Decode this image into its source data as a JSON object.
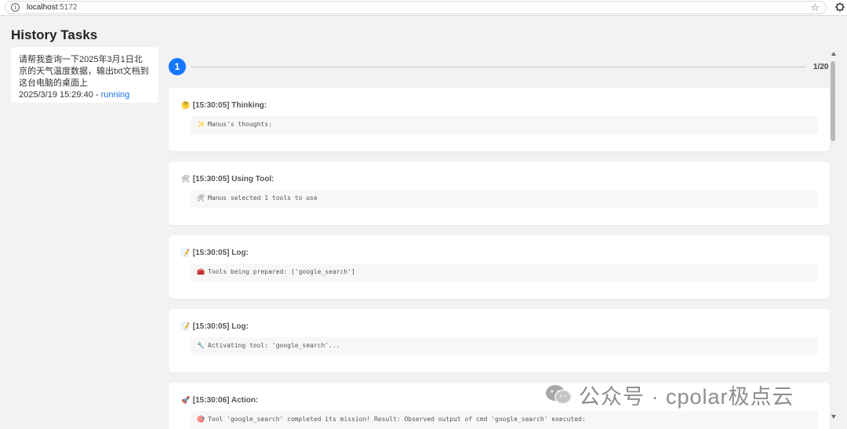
{
  "browser": {
    "url_host": "localhost",
    "url_port": ":5172"
  },
  "sidebar": {
    "title": "History Tasks",
    "tasks": [
      {
        "prompt": "请帮我查询一下2025年3月1日北京的天气温度数据，输出txt文档到这台电脑的桌面上",
        "timestamp": "2025/3/19 15:29:40",
        "separator": " - ",
        "status": "running"
      }
    ]
  },
  "stepper": {
    "current_step": "1",
    "count_label": "1/20"
  },
  "logs": [
    {
      "head_icon": "🤔",
      "title": "[15:30:05] Thinking:",
      "body_icon": "✨",
      "body": "Manus's thoughts:"
    },
    {
      "head_icon": "🛠",
      "title": "[15:30:05] Using Tool:",
      "body_icon": "🛠",
      "body": "Manus selected 1 tools to use"
    },
    {
      "head_icon": "📝",
      "title": "[15:30:05] Log:",
      "body_icon": "🧰",
      "body": "Tools being prepared: ['google_search']"
    },
    {
      "head_icon": "📝",
      "title": "[15:30:05] Log:",
      "body_icon": "🔧",
      "body": "Activating tool: 'google_search'..."
    },
    {
      "head_icon": "🚀",
      "title": "[15:30:06] Action:",
      "body_icon": "🎯",
      "body": "Tool 'google_search' completed its mission! Result: Observed output of cmd 'google_search' executed:"
    }
  ],
  "watermark": {
    "text": "公众号 · cpolar极点云"
  },
  "colors": {
    "accent": "#1677ff",
    "status_running": "#1a73e8",
    "background": "#f2f2f2"
  }
}
